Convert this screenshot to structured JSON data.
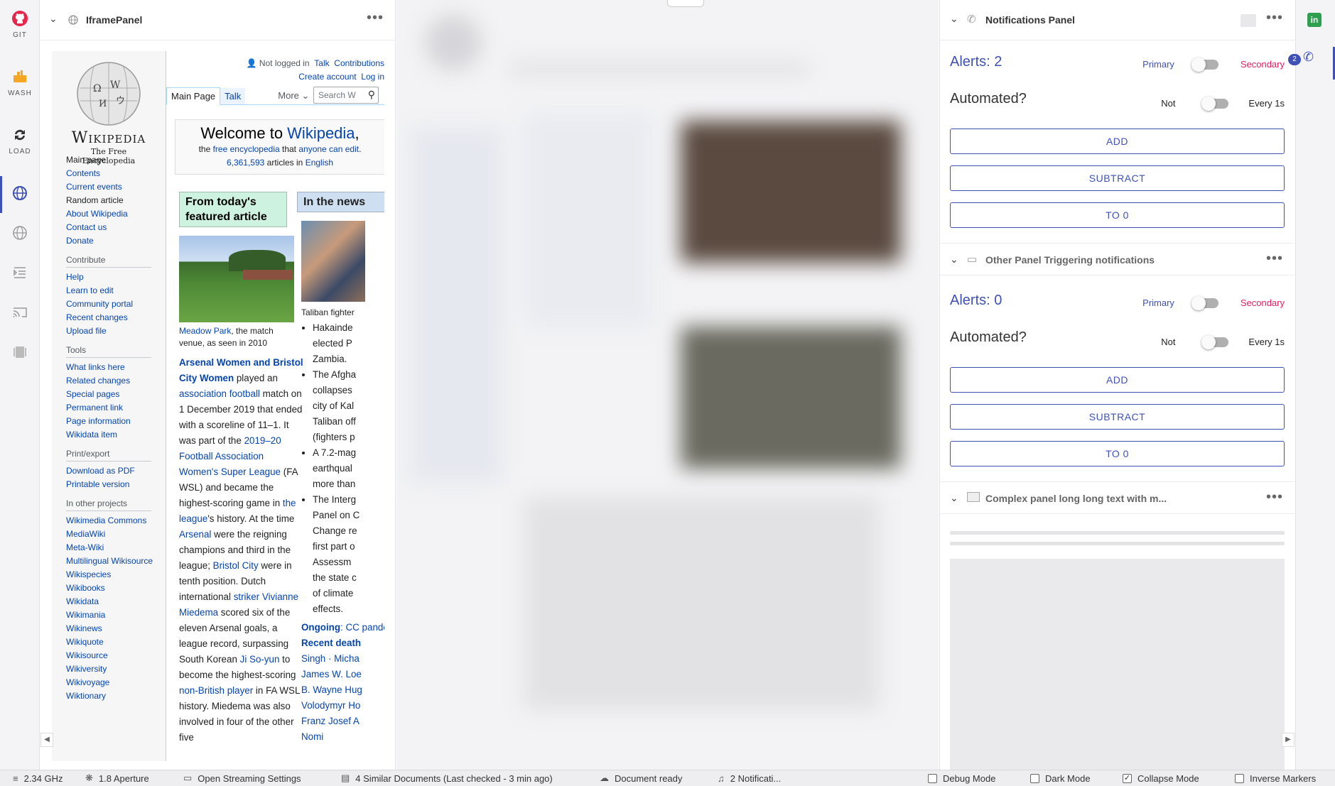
{
  "leftbar": {
    "items": [
      {
        "label": "GIT",
        "icon": "github-icon"
      },
      {
        "label": "WASH",
        "icon": "wash-icon"
      },
      {
        "label": "LOAD",
        "icon": "reload-icon"
      }
    ]
  },
  "iframe_panel": {
    "title": "IframePanel"
  },
  "wikipedia": {
    "logo_title": "Wikipedia",
    "logo_subtitle": "The Free Encyclopedia",
    "user_links": {
      "not_logged": "Not logged in",
      "talk": "Talk",
      "contributions": "Contributions",
      "create_account": "Create account",
      "log_in": "Log in"
    },
    "tabs": {
      "main_page": "Main Page",
      "talk": "Talk",
      "more": "More"
    },
    "search_placeholder": "Search W",
    "welcome": {
      "prefix": "Welcome to ",
      "link": "Wikipedia",
      "suffix": ",",
      "line2_a": "the ",
      "free_ency": "free encyclopedia",
      "line2_b": " that ",
      "anyone": "anyone can edit",
      "line2_c": ".",
      "count": "6,361,593",
      "articles_in": " articles in ",
      "english": "English"
    },
    "nav": [
      "Main page",
      "Contents",
      "Current events",
      "Random article",
      "About Wikipedia",
      "Contact us",
      "Donate"
    ],
    "contribute_h": "Contribute",
    "contribute": [
      "Help",
      "Learn to edit",
      "Community portal",
      "Recent changes",
      "Upload file"
    ],
    "tools_h": "Tools",
    "tools": [
      "What links here",
      "Related changes",
      "Special pages",
      "Permanent link",
      "Page information",
      "Wikidata item"
    ],
    "print_h": "Print/export",
    "print": [
      "Download as PDF",
      "Printable version"
    ],
    "projects_h": "In other projects",
    "projects": [
      "Wikimedia Commons",
      "MediaWiki",
      "Meta-Wiki",
      "Multilingual Wikisource",
      "Wikispecies",
      "Wikibooks",
      "Wikidata",
      "Wikimania",
      "Wikinews",
      "Wikiquote",
      "Wikisource",
      "Wikiversity",
      "Wikivoyage",
      "Wiktionary"
    ],
    "featured": {
      "heading": "From today's featured article",
      "caption_link": "Meadow Park",
      "caption_rest": ", the match venue, as seen in 2010",
      "bold_link": "Arsenal Women and Bristol City Women",
      "t1": " played an ",
      "l1": "association football",
      "t2": " match on 1 December 2019 that ended with a scoreline of 11–1. It was part of the ",
      "l2": "2019–20 Football Association Women's Super League",
      "t3": " (FA WSL) and became the highest-scoring game in ",
      "l3": "the league",
      "t4": "'s history. At the time ",
      "l4": "Arsenal",
      "t5": " were the reigning champions and third in the league; ",
      "l5": "Bristol City",
      "t6": " were in tenth position. Dutch international ",
      "l6": "striker",
      "t7": " ",
      "l7": "Vivianne Miedema",
      "t8": " scored six of the eleven Arsenal goals, a league record, surpassing South Korean ",
      "l8": "Ji So-yun",
      "t9": " to become the highest-scoring ",
      "l9": "non-British player",
      "t10": " in FA WSL history. Miedema was also involved in four of the other five"
    },
    "news": {
      "heading": "In the news",
      "caption": "Taliban fighter",
      "items": [
        "Hakainde",
        "elected P",
        "Zambia.",
        "The Afgha",
        "collapses",
        "city of Kal",
        "Taliban off",
        "(fighters p",
        "A 7.2-mag",
        "earthqual",
        "more than",
        "The Interg",
        "Panel on C",
        "Change re",
        "first part o",
        "Assessm",
        "the state c",
        "of climate",
        "effects."
      ],
      "ongoing_label": "Ongoing",
      "ongoing": ": CC pandemic",
      "recent": "Recent death",
      "names": [
        "Singh · Micha",
        "James W. Loe",
        "B. Wayne Hug",
        "Volodymyr Ho",
        "Franz Josef A",
        "Nomi"
      ]
    }
  },
  "notifications_panel": {
    "title": "Notifications Panel",
    "section1": {
      "alerts": "Alerts: 2",
      "primary": "Primary",
      "secondary": "Secondary",
      "automated": "Automated?",
      "not": "Not",
      "every": "Every 1s",
      "add": "ADD",
      "subtract": "SUBTRACT",
      "to0": "TO 0"
    },
    "sub_title": "Other Panel Triggering notifications",
    "section2": {
      "alerts": "Alerts: 0",
      "primary": "Primary",
      "secondary": "Secondary",
      "automated": "Automated?",
      "not": "Not",
      "every": "Every 1s",
      "add": "ADD",
      "subtract": "SUBTRACT",
      "to0": "TO 0"
    },
    "complex_title": "Complex panel long long text with m..."
  },
  "rightbar": {
    "badge": "2"
  },
  "status": {
    "cpu": "2.34 GHz",
    "aperture": "1.8 Aperture",
    "streaming": "Open Streaming Settings",
    "similar": "4 Similar Documents (Last checked - 3 min ago)",
    "doc": "Document ready",
    "notif": "2 Notificati...",
    "debug": "Debug Mode",
    "dark": "Dark Mode",
    "collapse": "Collapse Mode",
    "inverse": "Inverse Markers"
  },
  "colors": {
    "accent": "#3f51b5",
    "secondary": "#e91e63",
    "github": "#e8254a",
    "wash": "#f5a623"
  }
}
